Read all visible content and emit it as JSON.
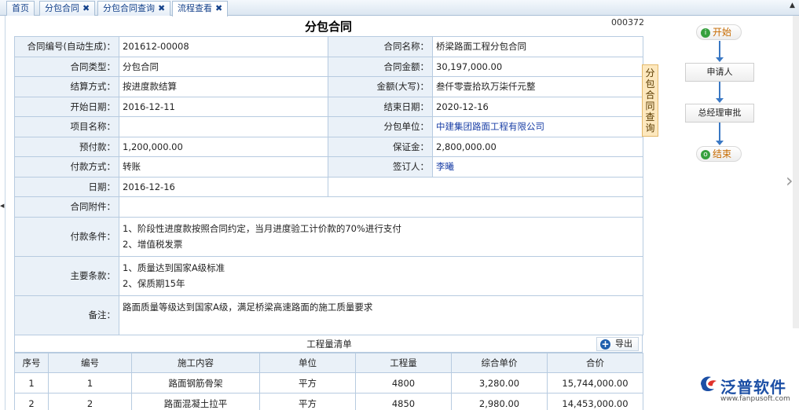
{
  "tabs": [
    {
      "label": "首页"
    },
    {
      "label": "分包合同"
    },
    {
      "label": "分包合同查询"
    },
    {
      "label": "流程查看"
    }
  ],
  "close_glyph": "✖",
  "doc_no": "000372",
  "title": "分包合同",
  "form": {
    "contract_no_label": "合同编号(自动生成)：",
    "contract_no": "201612-00008",
    "contract_name_label": "合同名称：",
    "contract_name": "桥梁路面工程分包合同",
    "contract_type_label": "合同类型：",
    "contract_type": "分包合同",
    "contract_amount_label": "合同金额：",
    "contract_amount": "30,197,000.00",
    "settle_label": "结算方式：",
    "settle": "按进度款结算",
    "amount_cn_label": "金额(大写)：",
    "amount_cn": "叁仟零壹拾玖万柒仟元整",
    "start_label": "开始日期：",
    "start": "2016-12-11",
    "end_label": "结束日期：",
    "end": "2020-12-16",
    "project_label": "项目名称：",
    "project": "",
    "sub_unit_label": "分包单位：",
    "sub_unit": "中建集团路面工程有限公司",
    "prepay_label": "预付款：",
    "prepay": "1,200,000.00",
    "deposit_label": "保证金：",
    "deposit": "2,800,000.00",
    "paymethod_label": "付款方式：",
    "paymethod": "转账",
    "signer_label": "签订人：",
    "signer": "李曦",
    "date_label": "日期：",
    "date": "2016-12-16",
    "attach_label": "合同附件：",
    "attach": "",
    "payterms_label": "付款条件：",
    "payterms_1": "1、阶段性进度款按照合同约定，当月进度验工计价款的70%进行支付",
    "payterms_2": "2、增值税发票",
    "mainterms_label": "主要条款：",
    "mainterms_1": "1、质量达到国家A级标准",
    "mainterms_2": "2、保质期15年",
    "remark_label": "备注：",
    "remark": "路面质量等级达到国家A级，满足桥梁高速路面的施工质量要求"
  },
  "quantity": {
    "title": "工程量清单",
    "export_label": "导出",
    "headers": [
      "序号",
      "编号",
      "施工内容",
      "单位",
      "工程量",
      "综合单价",
      "合价"
    ],
    "rows": [
      [
        "1",
        "1",
        "路面钢筋骨架",
        "平方",
        "4800",
        "3,280.00",
        "15,744,000.00"
      ],
      [
        "2",
        "2",
        "路面混凝土拉平",
        "平方",
        "4850",
        "2,980.00",
        "14,453,000.00"
      ]
    ]
  },
  "side_tab": "分包合同查询",
  "flow": {
    "start_label": "开始",
    "start_dot": "i",
    "node1": "申请人",
    "node2": "总经理审批",
    "end_label": "结束",
    "end_dot": "o"
  },
  "logo": {
    "name": "泛普软件",
    "url": "www.fanpusoft.com"
  },
  "colors": {
    "header_bg": "#eaf1f8",
    "border": "#b7cbe0",
    "link": "#1a3fa6",
    "flow_line": "#3a78c4",
    "side_tab_bg": "#fde8be"
  }
}
